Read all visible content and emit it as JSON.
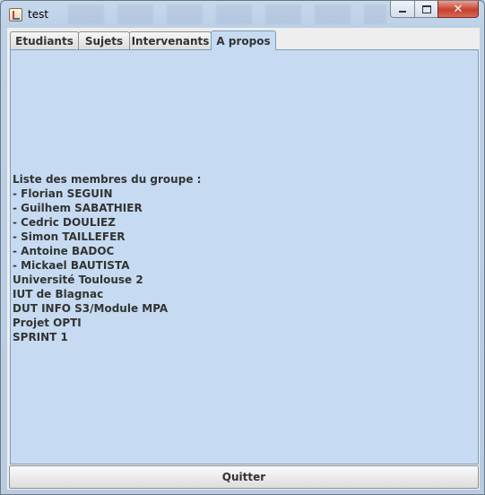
{
  "window": {
    "title": "test"
  },
  "tabs": [
    {
      "label": "Etudiants",
      "active": false
    },
    {
      "label": "Sujets",
      "active": false
    },
    {
      "label": "Intervenants",
      "active": false
    },
    {
      "label": "A propos",
      "active": true
    }
  ],
  "about": {
    "lines": [
      "Liste des membres du groupe :",
      "- Florian SEGUIN",
      "- Guilhem SABATHIER",
      "- Cedric DOULIEZ",
      "- Simon TAILLEFER",
      "- Antoine BADOC",
      "- Mickael BAUTISTA",
      "Université Toulouse 2",
      "IUT de Blagnac",
      "DUT INFO S3/Module MPA",
      "Projet OPTI",
      "SPRINT 1"
    ]
  },
  "footer": {
    "quit_label": "Quitter"
  },
  "icons": {
    "app": "java-app-icon",
    "minimize": "minimize-icon",
    "maximize": "maximize-icon",
    "close": "close-icon"
  },
  "colors": {
    "panel_background": "#c6dbf1",
    "close_button": "#c7402d"
  }
}
